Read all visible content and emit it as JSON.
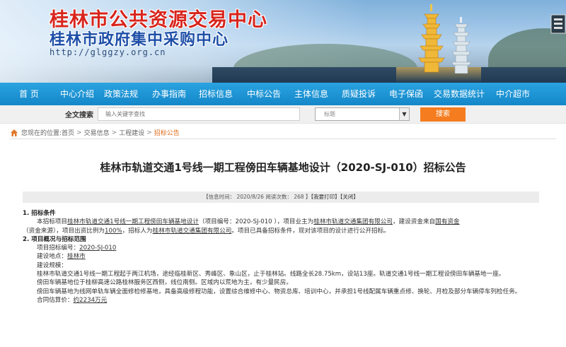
{
  "header": {
    "title_cn": "桂林市公共资源交易中心",
    "subtitle_cn": "桂林市政府集中采购中心",
    "url": "http://glggzy.org.cn"
  },
  "nav": {
    "items": [
      "首 页",
      "中心介绍",
      "政策法规",
      "办事指南",
      "招标信息",
      "中标公告",
      "主体信息",
      "质疑投诉",
      "电子保函",
      "交易数据统计",
      "中介超市"
    ]
  },
  "search": {
    "label": "全文搜索",
    "placeholder": "输入关键字查找",
    "select_value": "标题",
    "button": "搜索"
  },
  "breadcrumb": {
    "prefix": "您现在的位置:",
    "items": [
      "首页",
      "交易信息",
      "工程建设",
      "招标公告"
    ],
    "sep": ">"
  },
  "article": {
    "title": "桂林市轨道交通1号线一期工程傍田车辆基地设计（2020-SJ-010）招标公告",
    "info": {
      "date_text": "【信息时间： 2020/8/26  阅读次数： 268 】",
      "print": "【我要打印】",
      "close": "【关闭】"
    },
    "s1_title": "1.  招标条件",
    "s1_p1": {
      "a": "本招标项目",
      "project": "桂林市轨道交通1号线一期工程傍田车辆基地设计",
      "b": "（项目编号：2020-SJ-010   ），项目业主为",
      "owner": "桂林市轨道交通集团有限公司",
      "c": "，建设资金来自",
      "fund": "国有资金"
    },
    "s1_p2": {
      "a": "（资金来源）",
      "b": "，项目出资比例为",
      "ratio": "100%",
      "c": "，招标人为",
      "tenderer": "桂林市轨道交通集团有限公司",
      "d": "。项目已具备招标条件，现对该项目的设计进行公开招标。"
    },
    "s2_title": "2.  项目概况与招标范围",
    "s2": {
      "code_label": "项目招标编号：",
      "code": "2020-SJ-010",
      "place_label": "建设地点：",
      "place": "桂林市",
      "scale_label": "建设规模：",
      "scale_p1": "桂林市轨道交通1号线一期工程起于两江机场，途经临桂新区、秀峰区、象山区，止于桂林站。线路全长28.75km，设站13座。轨道交通1号线一期工程设傍田车辆基地一座。",
      "scale_p2": "傍田车辆基地位于桂柳高速公路桂林服务区西侧，线位南侧。区域内以荒地为主，有少量民房。",
      "scale_p3": "傍田车辆基地为线网单轨车辆全面修检修基地，具备高级修程功能，设置综合维修中心、物资总库、培训中心，并承担1号线配属车辆重点修、换轮、月检及部分车辆停车列检任务。",
      "cost_label": "合同估算价：",
      "cost": "约2234万元"
    }
  },
  "colors": {
    "nav_bg": "#1b94d6",
    "title_red": "#d8251d",
    "title_blue": "#1e4fa8",
    "search_btn": "#f57c1f",
    "breadcrumb_current": "#e06b1a"
  }
}
